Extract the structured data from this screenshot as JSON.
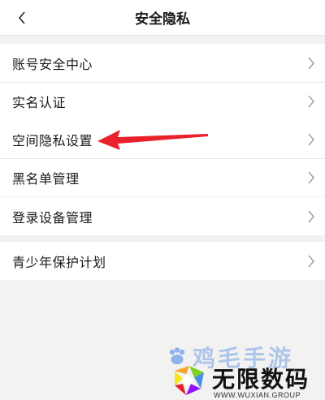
{
  "header": {
    "title": "安全隐私",
    "back_icon": "chevron-left-icon"
  },
  "groups": [
    {
      "items": [
        {
          "label": "账号安全中心"
        },
        {
          "label": "实名认证"
        }
      ]
    },
    {
      "items": [
        {
          "label": "空间隐私设置"
        },
        {
          "label": "黑名单管理"
        }
      ]
    },
    {
      "items": [
        {
          "label": "登录设备管理"
        }
      ]
    },
    {
      "items": [
        {
          "label": "青少年保护计划"
        }
      ]
    }
  ],
  "annotation": {
    "arrow_color": "#e8212b"
  },
  "watermark": {
    "top_text": "鸡毛手游",
    "brand": "无限数码",
    "site": "WWW.WUXIAN.GROUP"
  },
  "colors": {
    "background": "#f2f2f2",
    "row_background": "#ffffff",
    "chevron": "#9a9a9a"
  }
}
